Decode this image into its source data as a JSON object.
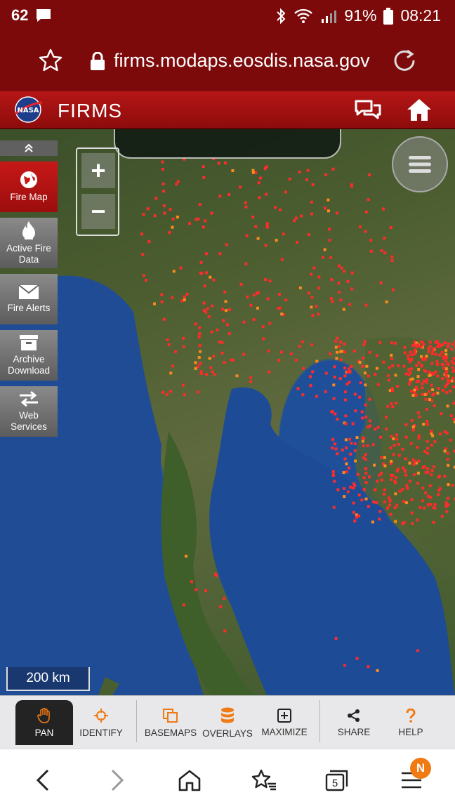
{
  "status_bar": {
    "notification_count": "62",
    "battery": "91%",
    "time": "08:21",
    "icons": [
      "message-icon",
      "bluetooth-icon",
      "wifi-icon",
      "signal-icon",
      "battery-icon"
    ]
  },
  "browser": {
    "url": "firms.modaps.eosdis.nasa.gov",
    "tab_count": "5",
    "menu_badge": "N"
  },
  "app": {
    "title": "FIRMS",
    "logo_text": "NASA"
  },
  "sidebar": {
    "items": [
      {
        "label_line1": "Fire Map",
        "label_line2": "",
        "icon": "globe-icon",
        "active": true
      },
      {
        "label_line1": "Active Fire",
        "label_line2": "Data",
        "icon": "flame-icon",
        "active": false
      },
      {
        "label_line1": "Fire Alerts",
        "label_line2": "",
        "icon": "envelope-icon",
        "active": false
      },
      {
        "label_line1": "Archive",
        "label_line2": "Download",
        "icon": "archive-box-icon",
        "active": false
      },
      {
        "label_line1": "Web",
        "label_line2": "Services",
        "icon": "exchange-arrows-icon",
        "active": false
      }
    ]
  },
  "map": {
    "zoom_in_label": "+",
    "zoom_out_label": "−",
    "scale_label": "200 km",
    "fire_color": "#ff2b2b"
  },
  "toolbar": {
    "items": [
      {
        "label": "PAN",
        "icon": "hand-icon",
        "active": true
      },
      {
        "label": "IDENTIFY",
        "icon": "crosshair-icon",
        "active": false
      },
      {
        "label": "BASEMAPS",
        "icon": "layers-icon",
        "active": false
      },
      {
        "label": "OVERLAYS",
        "icon": "database-icon",
        "active": false
      },
      {
        "label": "MAXIMIZE",
        "icon": "plus-square-icon",
        "active": false
      },
      {
        "label": "SHARE",
        "icon": "share-icon",
        "active": false
      },
      {
        "label": "HELP",
        "icon": "question-icon",
        "active": false
      }
    ]
  },
  "colors": {
    "header_red": "#b51616",
    "status_red": "#7d0a0a",
    "accent_orange": "#f07a14"
  }
}
